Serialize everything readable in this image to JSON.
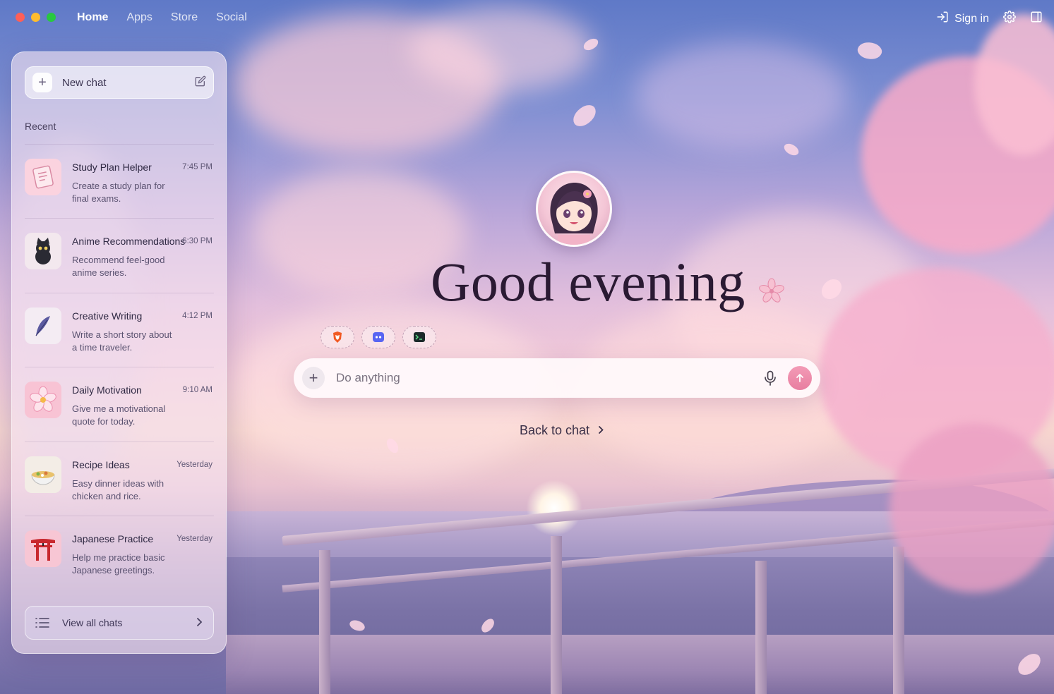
{
  "window": {
    "traffic_lights": {
      "close": "#fe5f57",
      "minimize": "#febc2e",
      "zoom": "#28c840"
    }
  },
  "nav": {
    "items": [
      {
        "label": "Home",
        "active": true
      },
      {
        "label": "Apps",
        "active": false
      },
      {
        "label": "Store",
        "active": false
      },
      {
        "label": "Social",
        "active": false
      }
    ]
  },
  "topright": {
    "signin_label": "Sign in",
    "icons": [
      "sign-in-icon",
      "gear-icon",
      "sidebar-toggle-icon"
    ]
  },
  "sidebar": {
    "new_chat_label": "New chat",
    "recent_label": "Recent",
    "view_all_label": "View all chats",
    "chats": [
      {
        "title": "Study Plan Helper",
        "time": "7:45 PM",
        "desc": "Create a study plan for final exams.",
        "icon": "notebook-icon"
      },
      {
        "title": "Anime Recommendations",
        "time": "6:30 PM",
        "desc": "Recommend feel-good anime series.",
        "icon": "black-cat-icon"
      },
      {
        "title": "Creative Writing",
        "time": "4:12 PM",
        "desc": "Write a short story about a time traveler.",
        "icon": "feather-quill-icon"
      },
      {
        "title": "Daily Motivation",
        "time": "9:10 AM",
        "desc": "Give me a motivational quote for today.",
        "icon": "cherry-blossom-icon"
      },
      {
        "title": "Recipe Ideas",
        "time": "Yesterday",
        "desc": "Easy dinner ideas with chicken and rice.",
        "icon": "rice-bowl-icon"
      },
      {
        "title": "Japanese Practice",
        "time": "Yesterday",
        "desc": "Help me practice basic Japanese greetings.",
        "icon": "torii-gate-icon"
      }
    ]
  },
  "main": {
    "greeting": "Good evening",
    "quick_actions": [
      "brave-browser-icon",
      "discord-icon",
      "terminal-icon"
    ],
    "search": {
      "placeholder": "Do anything"
    },
    "back_to_chat_label": "Back to chat"
  },
  "colors": {
    "accent": "#e87ea0",
    "sidebar_bg": "#f5e4f0",
    "greeting_text": "#2a1a33"
  }
}
